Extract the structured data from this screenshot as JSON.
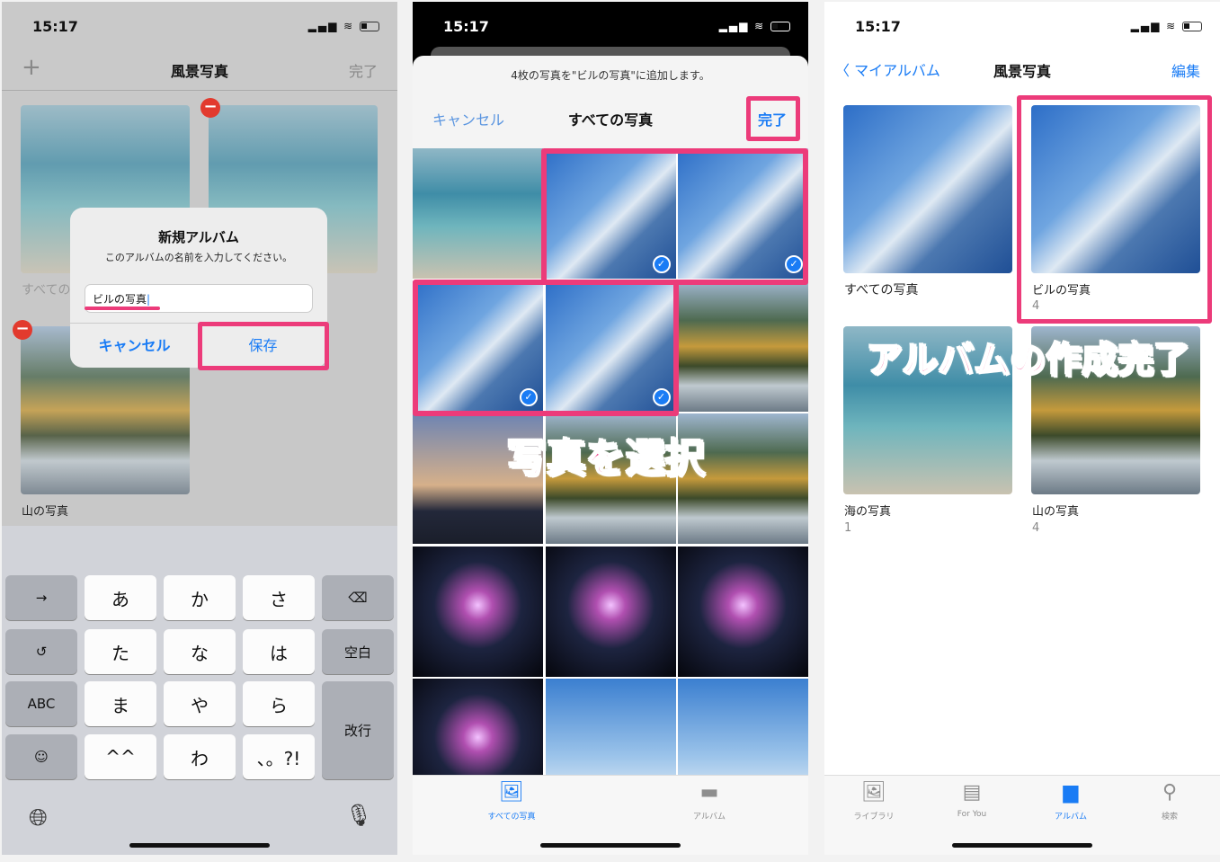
{
  "colors": {
    "accent": "#1a7cf5",
    "highlight": "#ec3b7a",
    "delete": "#e23a2e"
  },
  "panel1": {
    "status": {
      "time": "15:17"
    },
    "nav": {
      "add_icon": "plus-icon",
      "add": "+",
      "title": "風景写真",
      "done": "完了"
    },
    "albums": [
      {
        "name": "すべての写真"
      },
      {
        "name": ""
      },
      {
        "name": "山の写真"
      }
    ],
    "dialog": {
      "title": "新規アルバム",
      "message": "このアルバムの名前を入力してください。",
      "input_value": "ビルの写真",
      "cancel": "キャンセル",
      "save": "保存"
    },
    "keyboard": {
      "keys": [
        [
          "→",
          "あ",
          "か",
          "さ",
          "⌫"
        ],
        [
          "↺",
          "た",
          "な",
          "は",
          "空白"
        ],
        [
          "ABC",
          "ま",
          "や",
          "ら",
          "改行"
        ],
        [
          "☺",
          "^^",
          "わ",
          "、。?!"
        ]
      ],
      "globe_icon": "globe-icon",
      "mic_icon": "microphone-icon"
    }
  },
  "panel2": {
    "status": {
      "time": "15:17"
    },
    "header_message": "4枚の写真を\"ビルの写真\"に追加します。",
    "nav": {
      "cancel": "キャンセル",
      "title": "すべての写真",
      "done": "完了"
    },
    "annotation": "写真を選択",
    "tabs": [
      {
        "label": "すべての写真",
        "icon": "photo-icon",
        "active": true
      },
      {
        "label": "アルバム",
        "icon": "album-icon",
        "active": false
      }
    ]
  },
  "panel3": {
    "status": {
      "time": "15:17"
    },
    "nav": {
      "back": "マイアルバム",
      "title": "風景写真",
      "edit": "編集"
    },
    "albums": [
      {
        "name": "すべての写真",
        "count": ""
      },
      {
        "name": "ビルの写真",
        "count": "4"
      },
      {
        "name": "海の写真",
        "count": "1"
      },
      {
        "name": "山の写真",
        "count": "4"
      }
    ],
    "annotation": "アルバムの作成完了",
    "tabs": [
      {
        "label": "ライブラリ",
        "icon": "library-icon"
      },
      {
        "label": "For You",
        "icon": "for-you-icon"
      },
      {
        "label": "アルバム",
        "icon": "album-icon",
        "active": true
      },
      {
        "label": "検索",
        "icon": "search-icon"
      }
    ]
  }
}
